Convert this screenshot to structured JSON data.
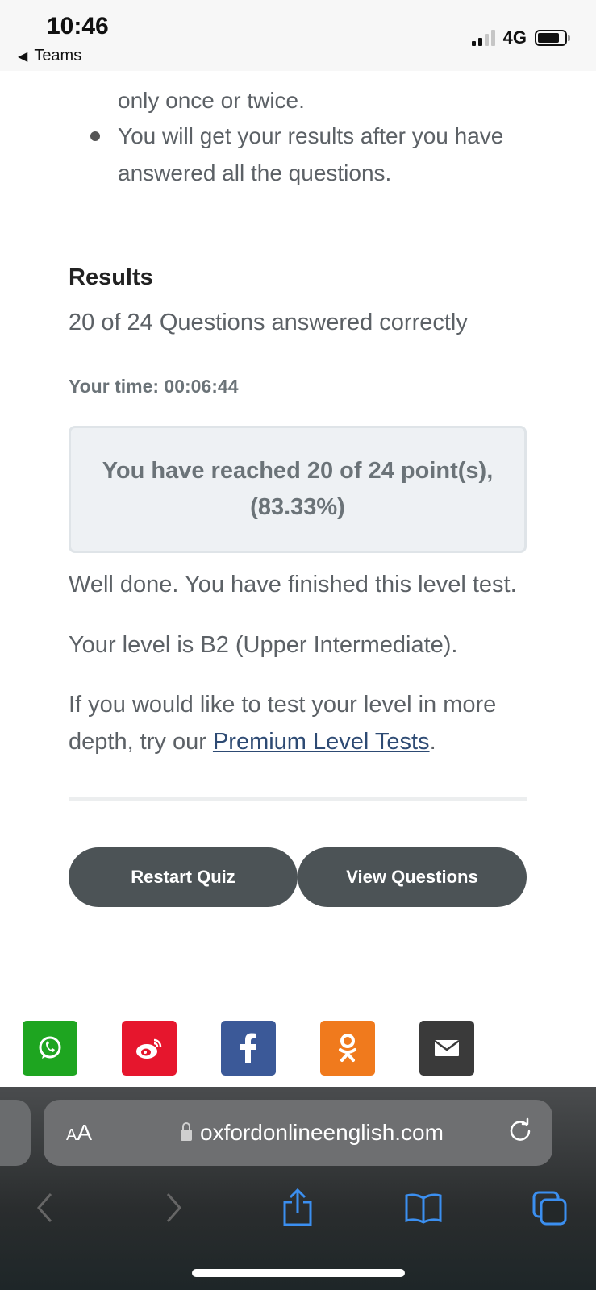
{
  "status": {
    "time": "10:46",
    "back_app": "Teams",
    "network": "4G"
  },
  "page": {
    "bullet_cont": "only once or twice.",
    "bullet": "You will get your results after you have answered all the questions.",
    "results_title": "Results",
    "answered": "20 of 24 Questions answered correctly",
    "your_time": "Your time: 00:06:44",
    "score_msg": "You have reached 20 of 24 point(s), (83.33%)",
    "well_done": "Well done. You have finished this level test.",
    "level": "Your level is B2 (Upper Intermediate).",
    "more_prefix": "If you would like to test your level in more depth, try our ",
    "more_link": "Premium Level Tests",
    "more_suffix": ".",
    "restart_label": "Restart Quiz",
    "view_label": "View Questions"
  },
  "share": [
    {
      "icon": "whatsapp-icon",
      "color": "#1ea520"
    },
    {
      "icon": "weibo-icon",
      "color": "#e6162d"
    },
    {
      "icon": "facebook-icon",
      "color": "#3b5998"
    },
    {
      "icon": "odnoklassniki-icon",
      "color": "#f07a1d"
    },
    {
      "icon": "email-icon",
      "color": "#3a3a3a"
    }
  ],
  "browser": {
    "aa_label": "AA",
    "url": "oxfordonlineenglish.com"
  }
}
